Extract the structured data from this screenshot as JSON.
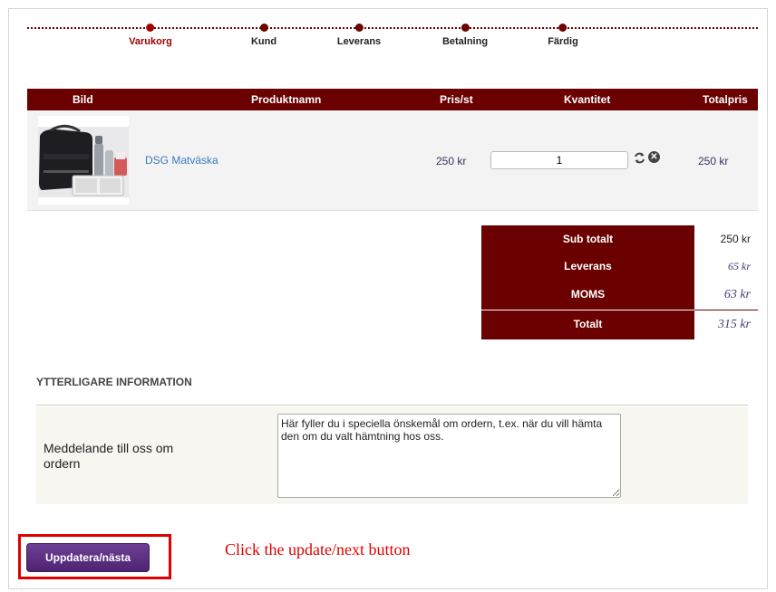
{
  "steps": [
    {
      "label": "Varukorg",
      "active": true
    },
    {
      "label": "Kund",
      "active": false
    },
    {
      "label": "Leverans",
      "active": false
    },
    {
      "label": "Betalning",
      "active": false
    },
    {
      "label": "Färdig",
      "active": false
    }
  ],
  "table": {
    "headers": [
      "Bild",
      "Produktnamn",
      "Pris/st",
      "Kvantitet",
      "Totalpris"
    ],
    "rows": [
      {
        "name": "DSG Matväska",
        "price": "250 kr",
        "quantity": "1",
        "total": "250 kr"
      }
    ]
  },
  "totals": {
    "subtotal_label": "Sub totalt",
    "subtotal_value": "250 kr",
    "shipping_label": "Leverans",
    "shipping_value": "65 kr",
    "vat_label": "MOMS",
    "vat_value": "63 kr",
    "total_label": "Totalt",
    "total_value": "315 kr"
  },
  "info": {
    "heading": "YTTERLIGARE INFORMATION",
    "message_label": "Meddelande till oss om ordern",
    "message_text": "Här fyller du i speciella önskemål om ordern, t.ex. när du vill hämta den om du valt hämtning hos oss."
  },
  "update_button": "Uppdatera/nästa",
  "annotation": "Click the update/next button",
  "colors": {
    "brand": "#6b0000",
    "button": "#5a2d82",
    "annotation": "#e00000"
  }
}
